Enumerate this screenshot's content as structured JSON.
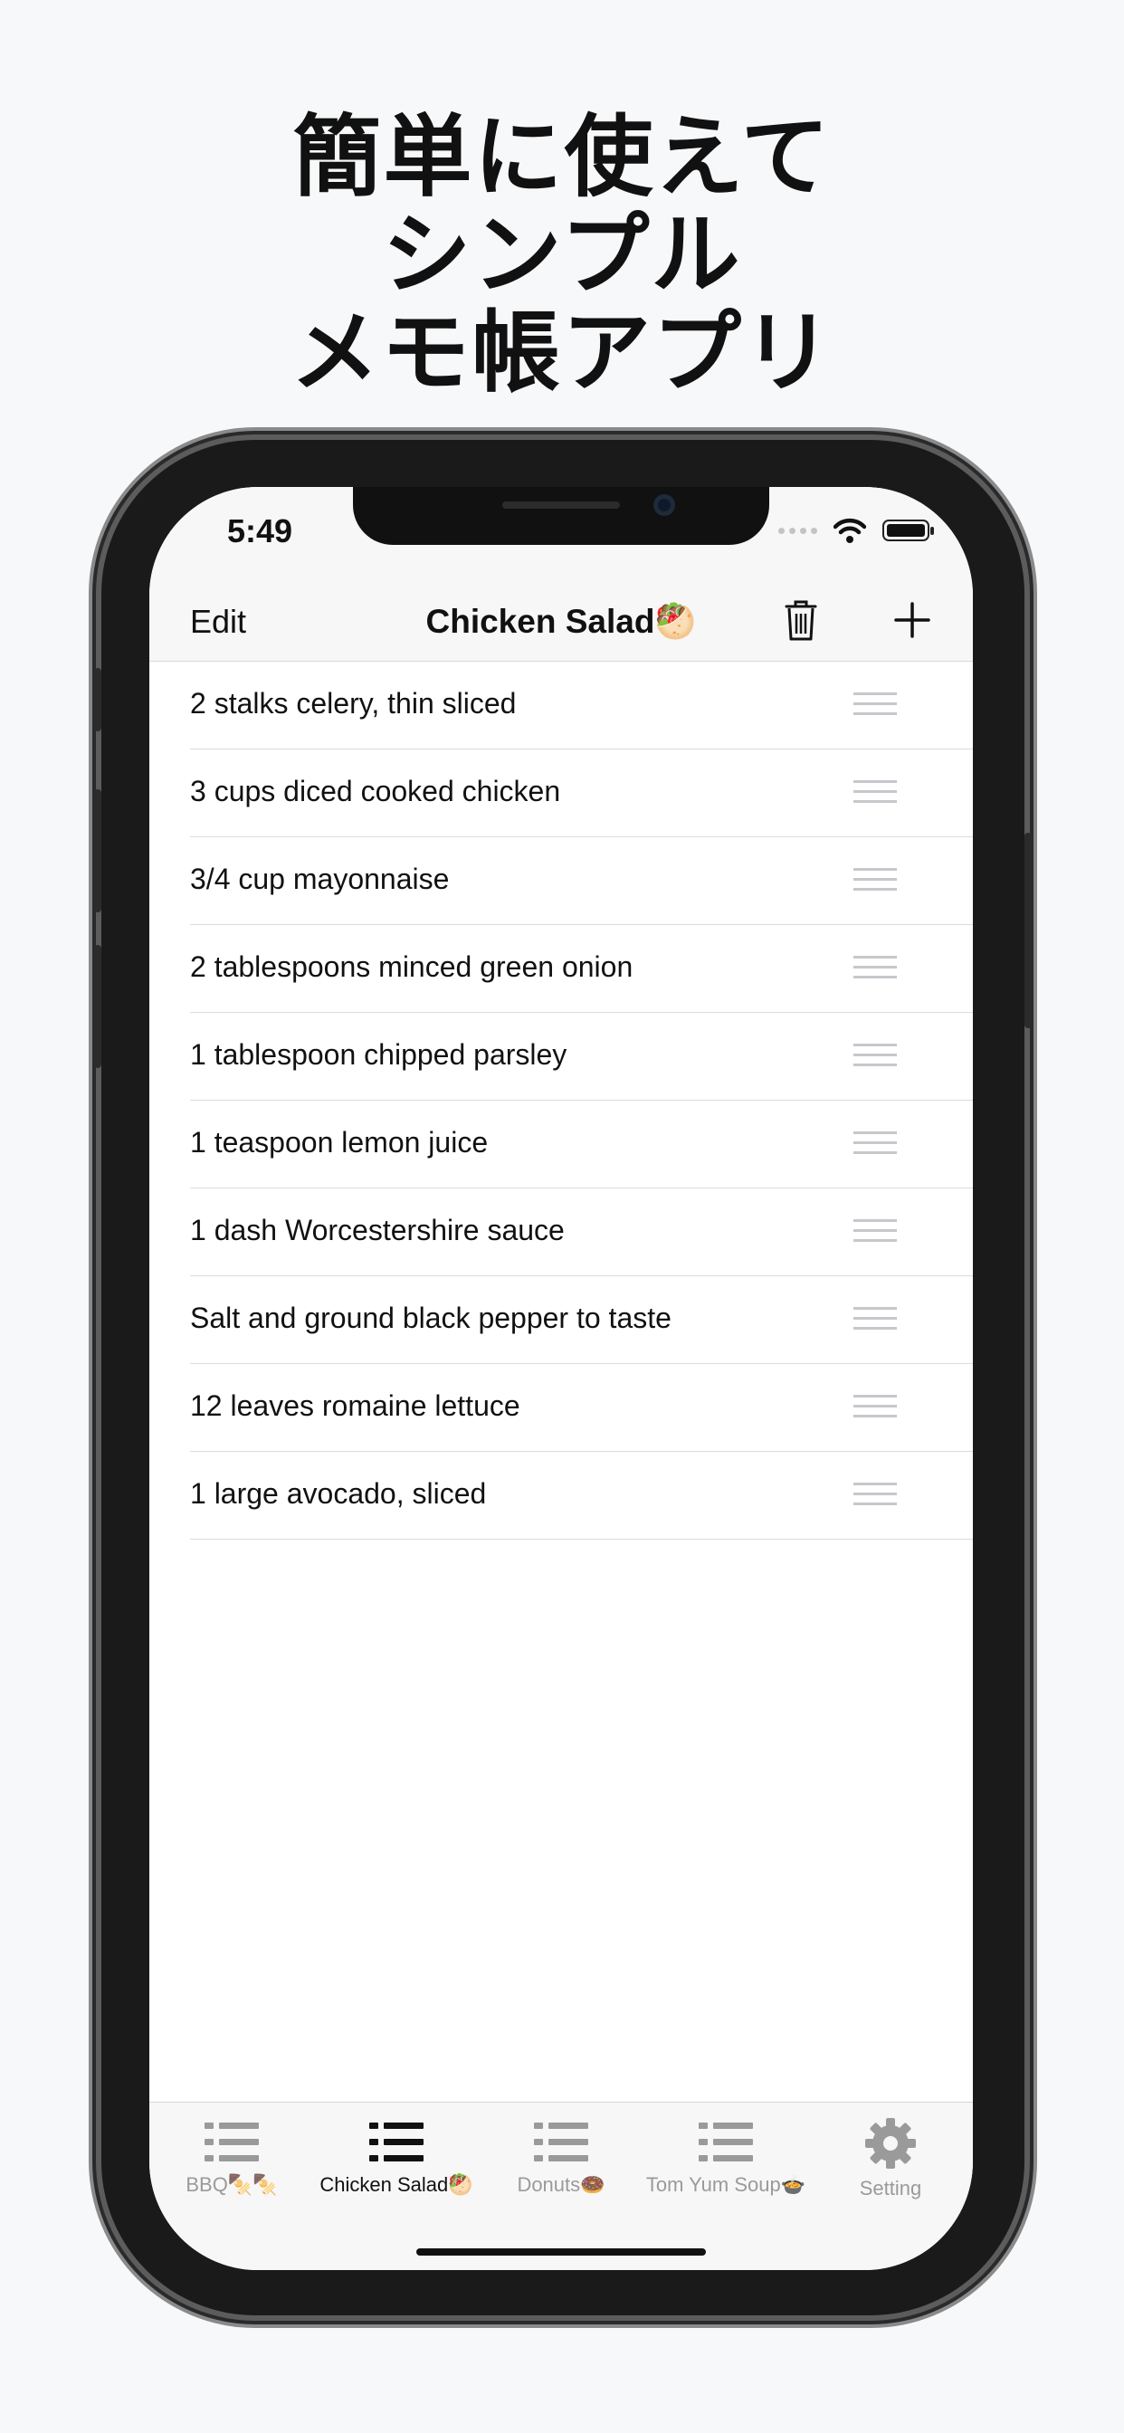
{
  "headline": [
    "簡単に使えて",
    "シンプル",
    "メモ帳アプリ"
  ],
  "status": {
    "time": "5:49"
  },
  "navbar": {
    "edit_label": "Edit",
    "title": "Chicken Salad🥙",
    "trash_icon": "trash-icon",
    "add_icon": "plus-icon"
  },
  "items": [
    "2 stalks celery, thin sliced",
    "3 cups diced cooked chicken",
    "3/4 cup mayonnaise",
    "2 tablespoons minced green onion",
    "1 tablespoon chipped parsley",
    "1 teaspoon lemon juice",
    "1 dash Worcestershire sauce",
    "Salt and ground black pepper to taste",
    "12 leaves romaine lettuce",
    "1 large avocado, sliced"
  ],
  "tabs": [
    {
      "label": "BBQ🍢🍢",
      "icon": "list-icon",
      "active": false
    },
    {
      "label": "Chicken Salad🥙",
      "icon": "list-icon",
      "active": true
    },
    {
      "label": "Donuts🍩",
      "icon": "list-icon",
      "active": false
    },
    {
      "label": "Tom Yum Soup🍲",
      "icon": "list-icon",
      "active": false
    },
    {
      "label": "Setting",
      "icon": "gear-icon",
      "active": false
    }
  ],
  "colors": {
    "background": "#f7f8fa",
    "active_tab": "#111111",
    "inactive_tab": "#9a9a9a"
  }
}
